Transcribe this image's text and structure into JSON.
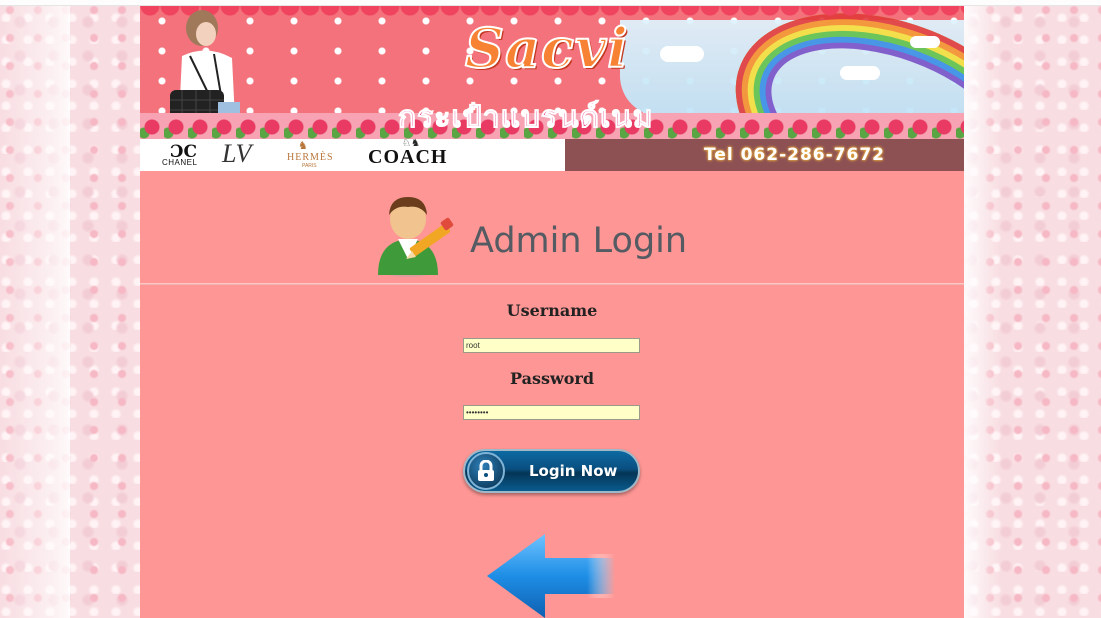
{
  "banner": {
    "brand_logo": "Sacvi",
    "thai_title": "กระเป๋าแบรนด์เนม",
    "brands": {
      "chanel": "CHANEL",
      "lv": "LV",
      "hermes": "HERMÈS",
      "hermes_sub": "PARIS",
      "coach": "COACH"
    },
    "tel": "Tel 062-286-7672"
  },
  "admin": {
    "title": "Admin Login"
  },
  "form": {
    "username_label": "Username",
    "username_value": "root",
    "password_label": "Password",
    "password_value": "••••••••",
    "login_label": "Login Now"
  },
  "colors": {
    "page_bg": "#fd9694",
    "input_bg": "#ffffc8",
    "button_blue": "#0a4f80",
    "tel_bar": "#8d5154"
  }
}
